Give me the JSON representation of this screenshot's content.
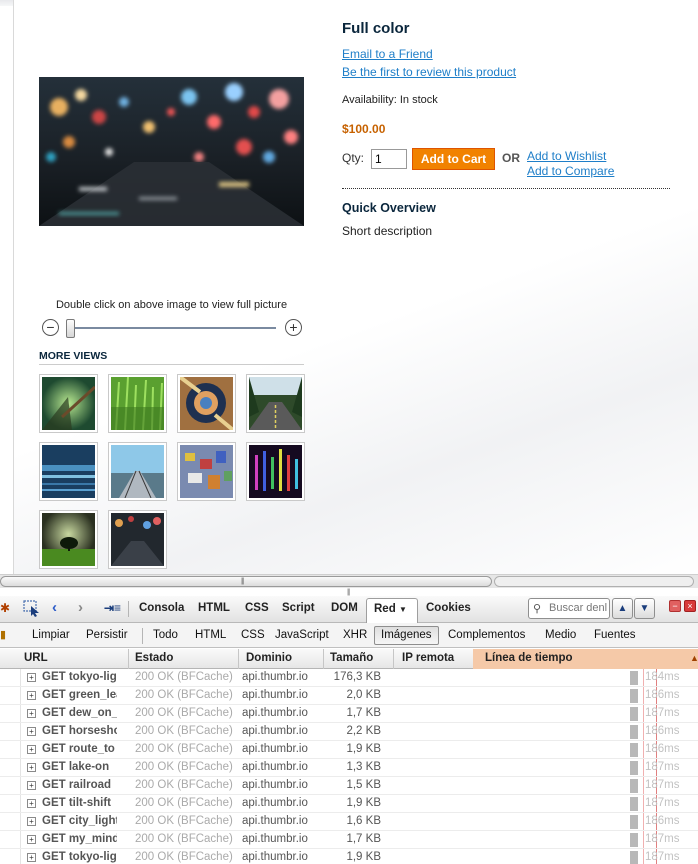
{
  "product": {
    "name": "Full color",
    "email_link": "Email to a Friend",
    "review_link": "Be the first to review this product",
    "availability": "Availability: In stock",
    "price": "$100.00",
    "qty_label": "Qty:",
    "qty_value": "1",
    "add_to_cart": "Add to Cart",
    "or_label": "OR",
    "wishlist": "Add to Wishlist",
    "compare": "Add to Compare",
    "overview_title": "Quick Overview",
    "short_description": "Short description",
    "zoom_hint": "Double click on above image to view full picture",
    "zoom_out": "−",
    "zoom_in": "+",
    "zoom_level": 0,
    "more_views": "MORE VIEWS",
    "thumbnails": [
      {
        "name": "forest-thumbnail"
      },
      {
        "name": "green-grass-thumbnail"
      },
      {
        "name": "dew-drop-thumbnail"
      },
      {
        "name": "forest-road-thumbnail"
      },
      {
        "name": "lake-thumbnail"
      },
      {
        "name": "railroad-thumbnail"
      },
      {
        "name": "tilt-shift-thumbnail"
      },
      {
        "name": "city-lights-thumbnail"
      },
      {
        "name": "lone-tree-thumbnail"
      },
      {
        "name": "tokyo-thumbnail"
      }
    ]
  },
  "firebug": {
    "tabs": [
      "Consola",
      "HTML",
      "CSS",
      "Script",
      "DOM",
      "Red",
      "Cookies"
    ],
    "active_tab": "Red",
    "search_placeholder": "Buscar denl",
    "sub_toolbar": {
      "clear": "Limpiar",
      "persist": "Persistir",
      "filters": [
        "Todo",
        "HTML",
        "CSS",
        "JavaScript",
        "XHR",
        "Imágenes",
        "Complementos",
        "Medio",
        "Fuentes"
      ],
      "active_filter": "Imágenes"
    },
    "columns": [
      "URL",
      "Estado",
      "Dominio",
      "Tamaño",
      "IP remota",
      "Línea de tiempo"
    ],
    "rows": [
      {
        "url": "GET tokyo-light",
        "status": "200 OK (BFCache)",
        "domain": "api.thumbr.io",
        "size": "176,3 KB",
        "time": "184ms"
      },
      {
        "url": "GET green_leaves",
        "status": "200 OK (BFCache)",
        "domain": "api.thumbr.io",
        "size": "2,0 KB",
        "time": "186ms"
      },
      {
        "url": "GET dew_on_grass",
        "status": "200 OK (BFCache)",
        "domain": "api.thumbr.io",
        "size": "1,7 KB",
        "time": "187ms"
      },
      {
        "url": "GET horseshoe",
        "status": "200 OK (BFCache)",
        "domain": "api.thumbr.io",
        "size": "2,2 KB",
        "time": "186ms"
      },
      {
        "url": "GET route_to",
        "status": "200 OK (BFCache)",
        "domain": "api.thumbr.io",
        "size": "1,9 KB",
        "time": "186ms"
      },
      {
        "url": "GET lake-on",
        "status": "200 OK (BFCache)",
        "domain": "api.thumbr.io",
        "size": "1,3 KB",
        "time": "187ms"
      },
      {
        "url": "GET railroad",
        "status": "200 OK (BFCache)",
        "domain": "api.thumbr.io",
        "size": "1,5 KB",
        "time": "187ms"
      },
      {
        "url": "GET tilt-shift",
        "status": "200 OK (BFCache)",
        "domain": "api.thumbr.io",
        "size": "1,9 KB",
        "time": "187ms"
      },
      {
        "url": "GET city_lights",
        "status": "200 OK (BFCache)",
        "domain": "api.thumbr.io",
        "size": "1,6 KB",
        "time": "186ms"
      },
      {
        "url": "GET my_mind",
        "status": "200 OK (BFCache)",
        "domain": "api.thumbr.io",
        "size": "1,7 KB",
        "time": "187ms"
      },
      {
        "url": "GET tokyo-light",
        "status": "200 OK (BFCache)",
        "domain": "api.thumbr.io",
        "size": "1,9 KB",
        "time": "187ms"
      }
    ]
  },
  "colors": {
    "link": "#1e7ec8",
    "price": "#c76200",
    "cart_button": "#f18200",
    "title": "#0a263c",
    "timeline_header": "#f5c9a8"
  }
}
